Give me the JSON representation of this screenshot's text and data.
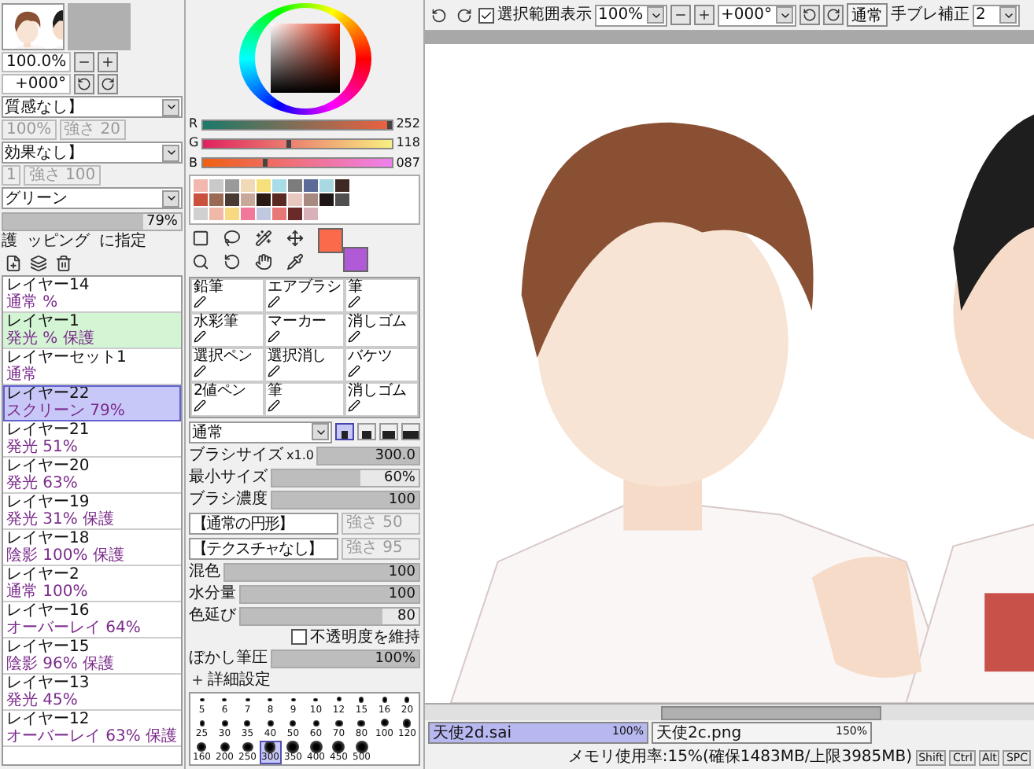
{
  "navigator": {
    "zoom": "100.0%",
    "rotation": "+000°"
  },
  "layer_settings": {
    "texture": "質感なし】",
    "texture_values": [
      "100%",
      "強さ 20"
    ],
    "effect": "効果なし】",
    "effect_values": [
      "1",
      "強さ 100"
    ],
    "blend_mode": "グリーン",
    "opacity": {
      "reading": "79%",
      "level": 0.79
    },
    "options": [
      "護",
      "ッピング",
      "に指定"
    ]
  },
  "layers": [
    {
      "name": "レイヤー14",
      "details": "通常 %",
      "selected": false,
      "highlighted": false
    },
    {
      "name": "レイヤー1",
      "details": "発光 % 保護",
      "selected": false,
      "highlighted": true
    },
    {
      "name": "レイヤーセット1",
      "details": "通常",
      "selected": false,
      "highlighted": false
    },
    {
      "name": "レイヤー22",
      "details": "スクリーン 79%",
      "selected": true,
      "highlighted": false
    },
    {
      "name": "レイヤー21",
      "details": "発光 51%",
      "selected": false,
      "highlighted": false
    },
    {
      "name": "レイヤー20",
      "details": "発光 63%",
      "selected": false,
      "highlighted": false
    },
    {
      "name": "レイヤー19",
      "details": "発光 31% 保護",
      "selected": false,
      "highlighted": false
    },
    {
      "name": "レイヤー18",
      "details": "陰影 100% 保護",
      "selected": false,
      "highlighted": false
    },
    {
      "name": "レイヤー2",
      "details": "通常 100%",
      "selected": false,
      "highlighted": false
    },
    {
      "name": "レイヤー16",
      "details": "オーバーレイ 64%",
      "selected": false,
      "highlighted": false
    },
    {
      "name": "レイヤー15",
      "details": "陰影 96% 保護",
      "selected": false,
      "highlighted": false
    },
    {
      "name": "レイヤー13",
      "details": "発光 45%",
      "selected": false,
      "highlighted": false
    },
    {
      "name": "レイヤー12",
      "details": "オーバーレイ 63% 保護",
      "selected": false,
      "highlighted": false
    }
  ],
  "rgb_sliders": [
    {
      "label": "R",
      "value": "252",
      "level": 0.99
    },
    {
      "label": "G",
      "value": "118",
      "level": 0.46
    },
    {
      "label": "B",
      "value": "087",
      "level": 0.34
    }
  ],
  "swatches": [
    {
      "color": "#f2b8b0"
    },
    {
      "color": "#c9c9c9"
    },
    {
      "color": "#9a9a9a"
    },
    {
      "color": "#f0d9b5"
    },
    {
      "color": "#f5e07a"
    },
    {
      "color": "#a8dde8"
    },
    {
      "color": "#7c7c7c"
    },
    {
      "color": "#5c6a9a"
    },
    {
      "color": "#a8d8e0"
    },
    {
      "color": "#3e2a22"
    },
    {
      "color": "#c9513e"
    },
    {
      "color": "#9a6a54"
    },
    {
      "color": "#4a3a34"
    },
    {
      "color": "#c8a898"
    },
    {
      "color": "#2a1a14"
    },
    {
      "color": "#5a2a22"
    },
    {
      "color": "#e8c8c0"
    },
    {
      "color": "#a88a80"
    },
    {
      "color": "#201818"
    },
    {
      "color": "#505050"
    },
    {
      "color": "#d0d0d0"
    },
    {
      "color": "#f0b8a8"
    },
    {
      "color": "#f8d880"
    },
    {
      "color": "#f07898"
    },
    {
      "color": "#c0c8e0"
    },
    {
      "color": "#e87878"
    },
    {
      "color": "#6a2a2a"
    },
    {
      "color": "#d8b0b8"
    }
  ],
  "colors": [
    {
      "kind": "primary",
      "color": "#fb6a4a"
    },
    {
      "kind": "secondary",
      "color": "#b05ad8"
    }
  ],
  "brush_tools": [
    "鉛筆",
    "エアブラシ",
    "筆",
    "水彩筆",
    "マーカー",
    "消しゴム",
    "選択ペン",
    "選択消し",
    "バケツ",
    "2値ペン",
    "筆",
    "消しゴム"
  ],
  "brush": {
    "mode": "通常",
    "shapes": [
      {
        "selected": true
      },
      {
        "selected": false
      },
      {
        "selected": false
      },
      {
        "selected": false
      }
    ],
    "size": {
      "label": "ブラシサイズ",
      "multiplier": "x1.0",
      "value": "300.0",
      "level": 1
    },
    "min_size": {
      "label": "最小サイズ",
      "value": "60%",
      "level": 0.6
    },
    "density": {
      "label": "ブラシ濃度",
      "value": "100",
      "level": 1
    },
    "shape": {
      "value": "【通常の円形】",
      "strength": "強さ 50"
    },
    "texture": {
      "value": "【テクスチャなし】",
      "strength": "強さ 95"
    },
    "blending": {
      "label": "混色",
      "value": "100",
      "level": 1
    },
    "dilution": {
      "label": "水分量",
      "value": "100",
      "level": 1
    },
    "persistence": {
      "label": "色延び",
      "value": "80",
      "level": 0.8
    },
    "keep_opacity": {
      "label": "不透明度を維持",
      "checked": false
    },
    "blur_pressure": {
      "label": "ぼかし筆圧",
      "value": "100%",
      "level": 1
    },
    "details": "詳細設定"
  },
  "brush_sizes": [
    {
      "label": "5",
      "selected": false
    },
    {
      "label": "6",
      "selected": false
    },
    {
      "label": "7",
      "selected": false
    },
    {
      "label": "8",
      "selected": false
    },
    {
      "label": "9",
      "selected": false
    },
    {
      "label": "10",
      "selected": false
    },
    {
      "label": "12",
      "selected": false
    },
    {
      "label": "15",
      "selected": false
    },
    {
      "label": "16",
      "selected": false
    },
    {
      "label": "20",
      "selected": false
    },
    {
      "label": "25",
      "selected": false
    },
    {
      "label": "30",
      "selected": false
    },
    {
      "label": "35",
      "selected": false
    },
    {
      "label": "40",
      "selected": false
    },
    {
      "label": "50",
      "selected": false
    },
    {
      "label": "60",
      "selected": false
    },
    {
      "label": "70",
      "selected": false
    },
    {
      "label": "80",
      "selected": false
    },
    {
      "label": "100",
      "selected": false
    },
    {
      "label": "120",
      "selected": false
    },
    {
      "label": "160",
      "selected": false
    },
    {
      "label": "200",
      "selected": false
    },
    {
      "label": "250",
      "selected": false
    },
    {
      "label": "300",
      "selected": true
    },
    {
      "label": "350",
      "selected": false
    },
    {
      "label": "400",
      "selected": false
    },
    {
      "label": "450",
      "selected": false
    },
    {
      "label": "500",
      "selected": false
    }
  ],
  "toolbar": {
    "show_selection": {
      "label": "選択範囲表示",
      "checked": true
    },
    "zoom": "100%",
    "rotation": "+000°",
    "blend": "通常",
    "stabilizer": {
      "label": "手ブレ補正",
      "value": "2"
    }
  },
  "documents": [
    {
      "name": "天使2d.sai",
      "zoom": "100%",
      "selected": true
    },
    {
      "name": "天使2c.png",
      "zoom": "150%",
      "selected": false
    }
  ],
  "status_bar": {
    "memory": "メモリ使用率:15%(確保1483MB/上限3985MB)",
    "keys": [
      "Shift",
      "Ctrl",
      "Alt",
      "SPC"
    ]
  }
}
